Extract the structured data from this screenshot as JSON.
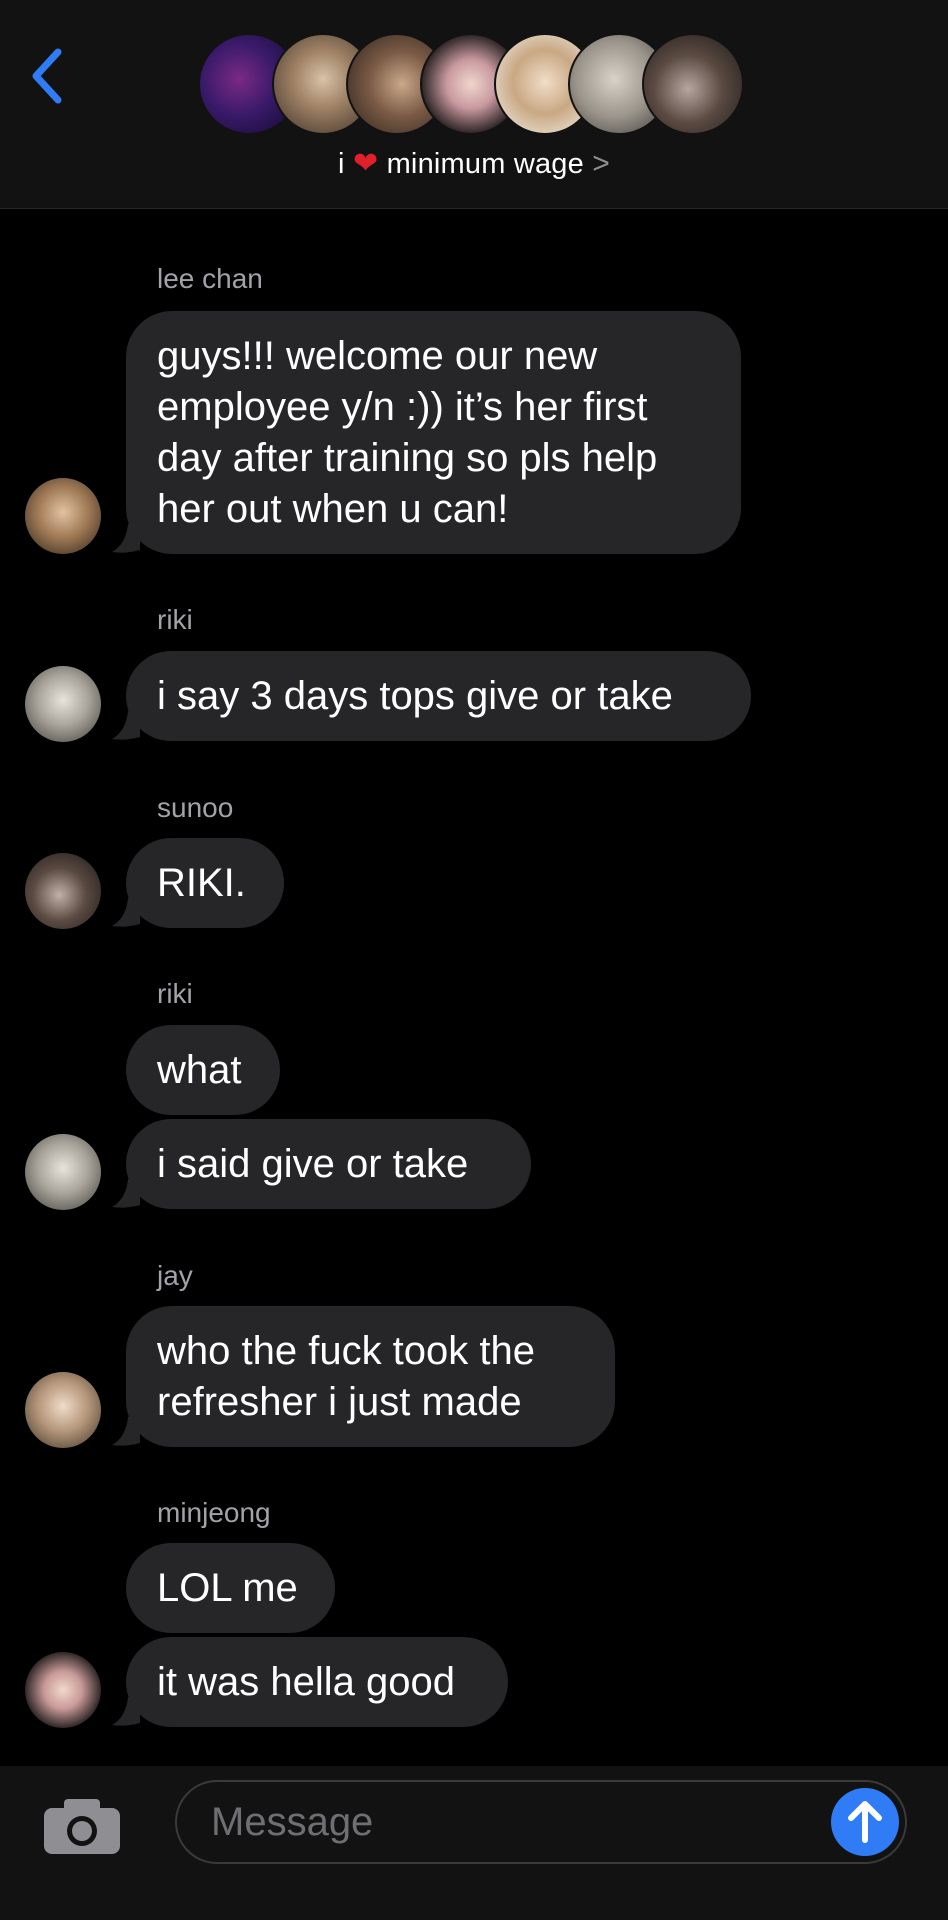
{
  "header": {
    "back_icon": "chevron-left-icon",
    "group_name_prefix": "i",
    "group_name_heart": "❤️",
    "group_name_suffix": "minimum wage",
    "chevron": ">",
    "member_avatars": [
      "dark-purple-plush",
      "boy-1",
      "boy-2",
      "girl-1",
      "boy-3",
      "boy-sunglasses",
      "boy-mirror-selfie"
    ]
  },
  "messages": [
    {
      "sender": "lee chan",
      "lines": [
        "guys!!! welcome our new",
        "employee y/n :)) it’s her first",
        "day after training so pls help",
        "her out when u can!"
      ]
    },
    {
      "sender": "riki",
      "lines": [
        "i say 3 days tops give or take"
      ]
    },
    {
      "sender": "sunoo",
      "lines": [
        "RIKI."
      ]
    },
    {
      "sender": "riki",
      "lines": [
        "what"
      ]
    },
    {
      "sender": "",
      "lines": [
        "i said give or take"
      ]
    },
    {
      "sender": "jay",
      "lines": [
        "who the fuck took the",
        "refresher i just made"
      ]
    },
    {
      "sender": "minjeong",
      "lines": [
        "LOL me"
      ]
    },
    {
      "sender": "",
      "lines": [
        "it was hella good"
      ]
    }
  ],
  "composer": {
    "placeholder": "Message",
    "camera_icon": "camera-icon",
    "send_icon": "arrow-up-icon"
  },
  "colors": {
    "accent": "#2f7cf6",
    "bubble": "#262629",
    "heart": "#e0202a",
    "background": "#000000"
  }
}
